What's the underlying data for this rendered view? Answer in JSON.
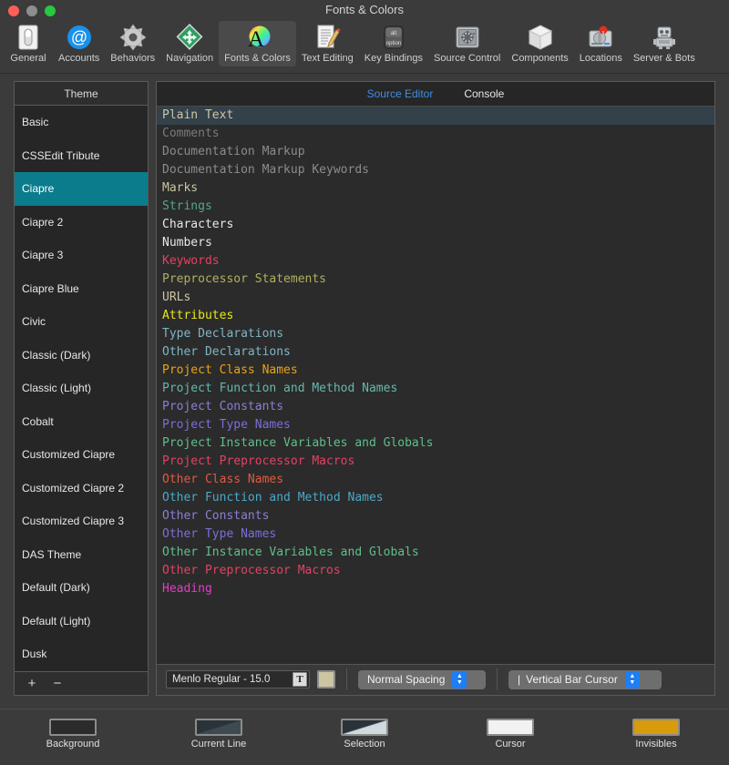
{
  "window": {
    "title": "Fonts & Colors",
    "traffic_lights": [
      "close-button",
      "minimize-button",
      "zoom-button"
    ]
  },
  "toolbar": {
    "items": [
      {
        "label": "General",
        "icon": "switch-icon",
        "active": false
      },
      {
        "label": "Accounts",
        "icon": "at-sign-icon",
        "active": false
      },
      {
        "label": "Behaviors",
        "icon": "gear-icon",
        "active": false
      },
      {
        "label": "Navigation",
        "icon": "move-diamond-icon",
        "active": false
      },
      {
        "label": "Fonts & Colors",
        "icon": "color-wheel-a-icon",
        "active": true
      },
      {
        "label": "Text Editing",
        "icon": "document-pencil-icon",
        "active": false
      },
      {
        "label": "Key Bindings",
        "icon": "option-key-icon",
        "active": false
      },
      {
        "label": "Source Control",
        "icon": "safe-vault-icon",
        "active": false
      },
      {
        "label": "Components",
        "icon": "cube-icon",
        "active": false
      },
      {
        "label": "Locations",
        "icon": "hard-drive-pin-icon",
        "active": false
      },
      {
        "label": "Server & Bots",
        "icon": "robot-icon",
        "active": false
      }
    ]
  },
  "theme_panel": {
    "header": "Theme",
    "selected": "Ciapre",
    "add_label": "+",
    "remove_label": "−",
    "items": [
      {
        "label": "Basic"
      },
      {
        "label": "CSSEdit Tribute"
      },
      {
        "label": "Ciapre"
      },
      {
        "label": "Ciapre 2"
      },
      {
        "label": "Ciapre 3"
      },
      {
        "label": "Ciapre Blue"
      },
      {
        "label": "Civic"
      },
      {
        "label": "Classic (Dark)"
      },
      {
        "label": "Classic (Light)"
      },
      {
        "label": "Cobalt"
      },
      {
        "label": "Customized Ciapre"
      },
      {
        "label": "Customized Ciapre 2"
      },
      {
        "label": "Customized Ciapre 3"
      },
      {
        "label": "DAS Theme"
      },
      {
        "label": "Default (Dark)"
      },
      {
        "label": "Default (Light)"
      },
      {
        "label": "Dusk"
      }
    ]
  },
  "main_panel": {
    "tabs": [
      {
        "label": "Source Editor",
        "active": true
      },
      {
        "label": "Console",
        "active": false
      }
    ],
    "selection_bg": "#33414a",
    "syntax_items": [
      {
        "label": "Plain Text",
        "color": "#cdc5a2",
        "selected": true
      },
      {
        "label": "Comments",
        "color": "#7b7b7b",
        "selected": false
      },
      {
        "label": "Documentation Markup",
        "color": "#8c8c8c",
        "selected": false
      },
      {
        "label": "Documentation Markup Keywords",
        "color": "#8c8c8c",
        "selected": false
      },
      {
        "label": "Marks",
        "color": "#cdc5a2",
        "selected": false
      },
      {
        "label": "Strings",
        "color": "#55a884",
        "selected": false
      },
      {
        "label": "Characters",
        "color": "#e8e8e8",
        "selected": false
      },
      {
        "label": "Numbers",
        "color": "#e8e8e8",
        "selected": false
      },
      {
        "label": "Keywords",
        "color": "#e34262",
        "selected": false
      },
      {
        "label": "Preprocessor Statements",
        "color": "#b0b060",
        "selected": false
      },
      {
        "label": "URLs",
        "color": "#cdc5a2",
        "selected": false
      },
      {
        "label": "Attributes",
        "color": "#e8e818",
        "selected": false
      },
      {
        "label": "Type Declarations",
        "color": "#7fb5c4",
        "selected": false
      },
      {
        "label": "Other Declarations",
        "color": "#7fb5c4",
        "selected": false
      },
      {
        "label": "Project Class Names",
        "color": "#e8a317",
        "selected": false
      },
      {
        "label": "Project Function and Method Names",
        "color": "#64b8aa",
        "selected": false
      },
      {
        "label": "Project Constants",
        "color": "#8a7fd4",
        "selected": false
      },
      {
        "label": "Project Type Names",
        "color": "#7a6fd8",
        "selected": false
      },
      {
        "label": "Project Instance Variables and Globals",
        "color": "#5fbf8a",
        "selected": false
      },
      {
        "label": "Project Preprocessor Macros",
        "color": "#e34262",
        "selected": false
      },
      {
        "label": "Other Class Names",
        "color": "#e05a42",
        "selected": false
      },
      {
        "label": "Other Function and Method Names",
        "color": "#4aa8c8",
        "selected": false
      },
      {
        "label": "Other Constants",
        "color": "#8a7fd4",
        "selected": false
      },
      {
        "label": "Other Type Names",
        "color": "#7a6fd8",
        "selected": false
      },
      {
        "label": "Other Instance Variables and Globals",
        "color": "#5fbf8a",
        "selected": false
      },
      {
        "label": "Other Preprocessor Macros",
        "color": "#e34262",
        "selected": false
      },
      {
        "label": "Heading",
        "color": "#e040c0",
        "selected": false
      }
    ]
  },
  "font_bar": {
    "font_value": "Menlo Regular - 15.0",
    "font_button_glyph": "T",
    "font_color_swatch": "#cdc5a2",
    "spacing_value": "Normal Spacing",
    "cursor_value": "Vertical Bar Cursor",
    "cursor_glyph": "|"
  },
  "swatches": [
    {
      "label": "Background",
      "fill": "#2b2b2b",
      "style": "solid"
    },
    {
      "label": "Current Line",
      "fill": "#3d4a52",
      "style": "diagonal"
    },
    {
      "label": "Selection",
      "fill": "#cfdade",
      "style": "diagonal"
    },
    {
      "label": "Cursor",
      "fill": "#f2f2f2",
      "style": "solid"
    },
    {
      "label": "Invisibles",
      "fill": "#d79b0b",
      "style": "solid"
    }
  ]
}
